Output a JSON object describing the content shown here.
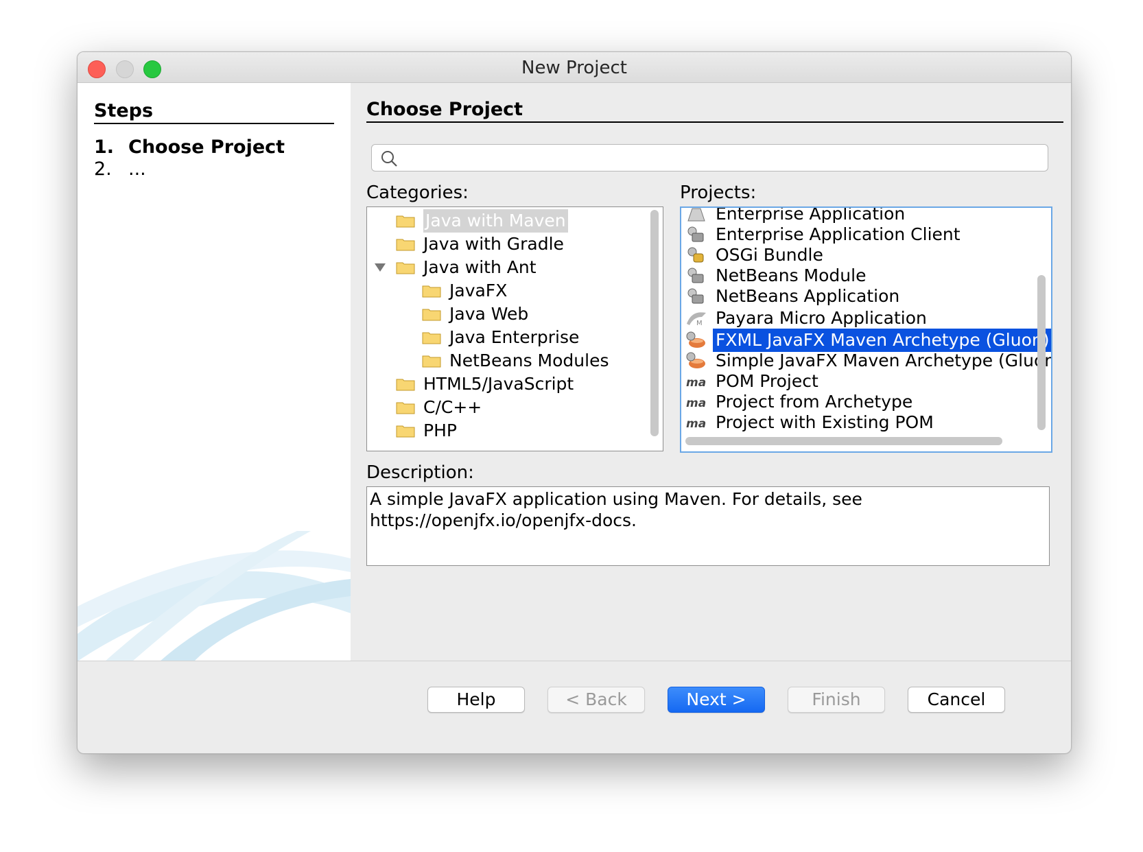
{
  "window": {
    "title": "New Project"
  },
  "steps": {
    "heading": "Steps",
    "items": [
      {
        "num": "1.",
        "label": "Choose Project"
      },
      {
        "num": "2.",
        "label": "..."
      }
    ]
  },
  "main": {
    "title": "Choose Project",
    "search": {
      "value": "",
      "placeholder": ""
    },
    "categories_label": "Categories:",
    "projects_label": "Projects:",
    "description_label": "Description:",
    "description": "A simple JavaFX application using Maven. For details, see https://openjfx.io/openjfx-docs."
  },
  "categories": [
    {
      "label": "Java with Maven",
      "level": 0,
      "selected": true
    },
    {
      "label": "Java with Gradle",
      "level": 0
    },
    {
      "label": "Java with Ant",
      "level": 0,
      "expanded": true
    },
    {
      "label": "JavaFX",
      "level": 1
    },
    {
      "label": "Java Web",
      "level": 1
    },
    {
      "label": "Java Enterprise",
      "level": 1
    },
    {
      "label": "NetBeans Modules",
      "level": 1
    },
    {
      "label": "HTML5/JavaScript",
      "level": 0
    },
    {
      "label": "C/C++",
      "level": 0
    },
    {
      "label": "PHP",
      "level": 0
    }
  ],
  "projects": [
    {
      "label": "Enterprise Application",
      "icon": "enterprise-app-icon"
    },
    {
      "label": "Enterprise Application Client",
      "icon": "enterprise-client-icon"
    },
    {
      "label": "OSGi Bundle",
      "icon": "osgi-bundle-icon"
    },
    {
      "label": "NetBeans Module",
      "icon": "netbeans-module-icon"
    },
    {
      "label": "NetBeans Application",
      "icon": "netbeans-app-icon"
    },
    {
      "label": "Payara Micro Application",
      "icon": "payara-micro-icon"
    },
    {
      "label": "FXML JavaFX Maven Archetype (Gluon)",
      "icon": "javafx-maven-icon",
      "selected": true
    },
    {
      "label": "Simple JavaFX Maven Archetype (Gluon)",
      "icon": "javafx-maven-icon"
    },
    {
      "label": "POM Project",
      "icon": "maven-icon"
    },
    {
      "label": "Project from Archetype",
      "icon": "maven-icon"
    },
    {
      "label": "Project with Existing POM",
      "icon": "maven-icon"
    }
  ],
  "buttons": {
    "help": "Help",
    "back": "< Back",
    "next": "Next >",
    "finish": "Finish",
    "cancel": "Cancel"
  },
  "colors": {
    "selection_blue": "#0a52e0",
    "primary_button": "#1569f2",
    "folder": "#f8d672"
  }
}
